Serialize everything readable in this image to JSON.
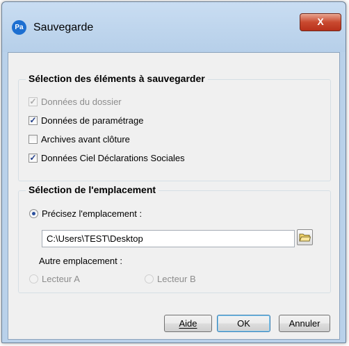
{
  "window": {
    "title": "Sauvegarde",
    "icon_text": "Pa",
    "close_glyph": "X"
  },
  "section_items": {
    "legend": "Sélection des éléments à sauvegarder",
    "items": [
      {
        "label": "Données du dossier",
        "checked": true,
        "disabled": true
      },
      {
        "label": "Données de paramétrage",
        "checked": true,
        "disabled": false
      },
      {
        "label": "Archives avant clôture",
        "checked": false,
        "disabled": false
      },
      {
        "label": "Données Ciel Déclarations Sociales",
        "checked": true,
        "disabled": false
      }
    ]
  },
  "section_location": {
    "legend": "Sélection de l'emplacement",
    "specify_label": "Précisez l'emplacement :",
    "path_value": "C:\\Users\\TEST\\Desktop",
    "other_label": "Autre emplacement :",
    "drive_a": "Lecteur A",
    "drive_b": "Lecteur B"
  },
  "buttons": {
    "help": "Aide",
    "ok": "OK",
    "cancel": "Annuler"
  }
}
